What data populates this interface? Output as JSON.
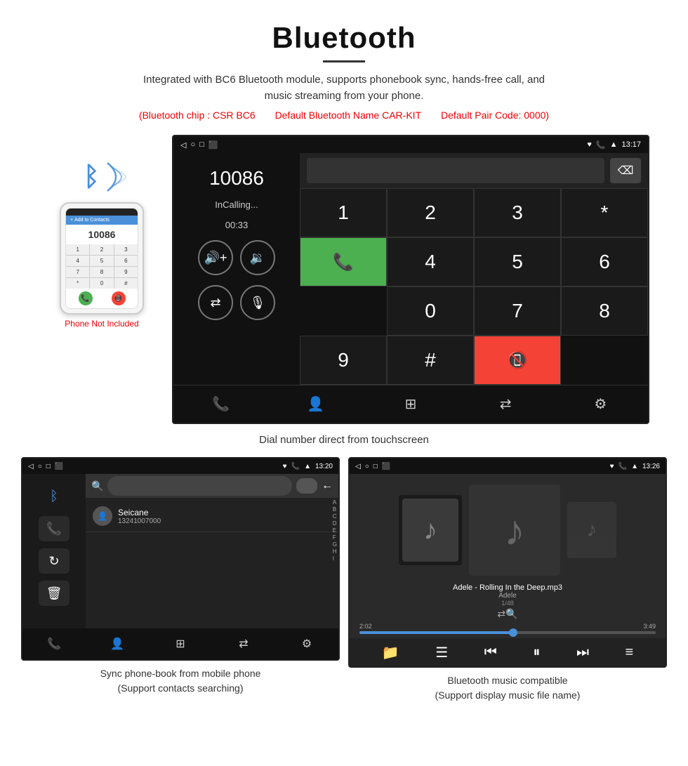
{
  "header": {
    "title": "Bluetooth",
    "subtitle": "Integrated with BC6 Bluetooth module, supports phonebook sync, hands-free call, and music streaming from your phone.",
    "specs": [
      "(Bluetooth chip : CSR BC6",
      "Default Bluetooth Name CAR-KIT",
      "Default Pair Code: 0000)"
    ]
  },
  "main_screen": {
    "status_bar": {
      "nav_icons": [
        "◁",
        "○",
        "□",
        "⬛"
      ],
      "status_icons": [
        "♥",
        "📞",
        "▲",
        "13:17"
      ]
    },
    "call_panel": {
      "number": "10086",
      "status": "InCalling...",
      "timer": "00:33"
    },
    "dialpad": {
      "keys": [
        "1",
        "2",
        "3",
        "*",
        "4",
        "5",
        "6",
        "0",
        "7",
        "8",
        "9",
        "#"
      ]
    },
    "caption": "Dial number direct from touchscreen"
  },
  "phone_illustration": {
    "not_included": "Phone Not Included"
  },
  "bottom_left": {
    "caption_line1": "Sync phone-book from mobile phone",
    "caption_line2": "(Support contacts searching)",
    "contact": {
      "name": "Seicane",
      "phone": "13241007000"
    },
    "status_bar_time": "13:20",
    "alpha_list": [
      "A",
      "B",
      "C",
      "D",
      "E",
      "F",
      "G",
      "H",
      "I"
    ]
  },
  "bottom_right": {
    "caption_line1": "Bluetooth music compatible",
    "caption_line2": "(Support display music file name)",
    "track_name": "Adele - Rolling In the Deep.mp3",
    "artist": "Adele",
    "track_count": "1/48",
    "time_current": "2:02",
    "time_total": "3:49",
    "status_bar_time": "13:26"
  },
  "icons": {
    "bluetooth": "ᛒ",
    "phone": "📞",
    "music_note": "♪",
    "shuffle": "⇄",
    "search": "🔍",
    "prev": "⏮",
    "play": "⏸",
    "next": "⏭",
    "equalizer": "≡",
    "back": "←",
    "volume_up": "🔊",
    "volume_down": "🔉",
    "transfer": "⇄",
    "mic": "🎙",
    "call": "📞",
    "end_call": "📵",
    "contacts": "👤",
    "grid": "⊞",
    "settings": "⚙",
    "delete": "🗑"
  }
}
